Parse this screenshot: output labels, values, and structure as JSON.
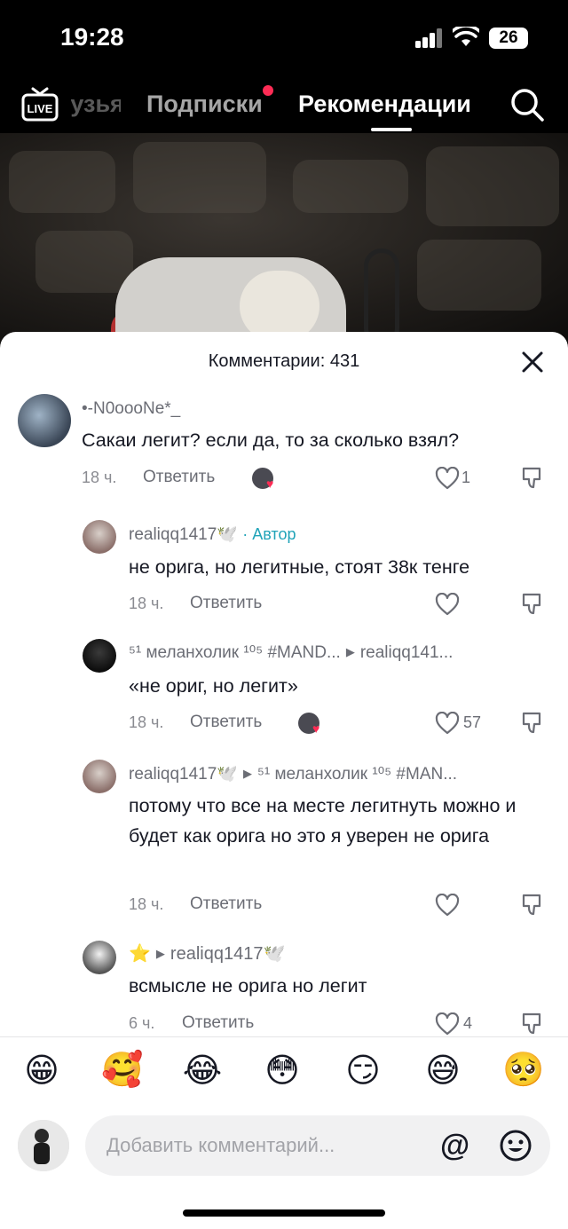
{
  "status_bar": {
    "time": "19:28",
    "battery": "26"
  },
  "top_nav": {
    "tabs": [
      "Друзья",
      "Подписки",
      "Рекомендации"
    ],
    "active_tab": "Рекомендации",
    "live_icon": "live-tv-icon",
    "search_icon": "search-icon"
  },
  "sheet": {
    "title": "Комментарии: 431"
  },
  "comments": [
    {
      "user": "•-N0oooNe*_",
      "text": "Сакаи легит? если да, то за сколько взял?",
      "time": "18 ч.",
      "reply": "Ответить",
      "likes": "1",
      "liked_by_author": true
    },
    {
      "user": "realiqq1417🕊️",
      "author_badge": "· Автор",
      "text": "не орига, но легитные, стоят 38к тенге",
      "time": "18 ч.",
      "reply": "Ответить",
      "likes": ""
    },
    {
      "user": "⁵¹ меланхолик ¹⁰⁵ #MAND...",
      "reply_to": "realiqq141...",
      "text": "«не ориг, но легит»",
      "time": "18 ч.",
      "reply": "Ответить",
      "likes": "57",
      "liked_by_author": true
    },
    {
      "user": "realiqq1417🕊️",
      "reply_to": "⁵¹ меланхолик ¹⁰⁵ #MAN...",
      "text": "потому что все на месте легитнуть можно и будет как орига но это я уверен не орига",
      "time": "18 ч.",
      "reply": "Ответить",
      "likes": ""
    },
    {
      "user": "⭐",
      "reply_to": "realiqq1417🕊️",
      "text": "всмысле не орига но легит",
      "time": "6 ч.",
      "reply": "Ответить",
      "likes": "4"
    }
  ],
  "emoji_bar": [
    "😁",
    "🥰",
    "😂",
    "😳",
    "😏",
    "😅",
    "🥺"
  ],
  "composer": {
    "placeholder": "Добавить комментарий...",
    "at_symbol": "@"
  },
  "colors": {
    "accent": "#fe2c55",
    "author": "#20a3b8"
  }
}
